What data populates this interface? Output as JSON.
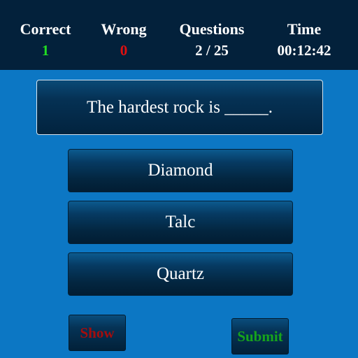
{
  "stats": {
    "correct": {
      "label": "Correct",
      "value": "1"
    },
    "wrong": {
      "label": "Wrong",
      "value": "0"
    },
    "questions": {
      "label": "Questions",
      "value": "2 / 25"
    },
    "time": {
      "label": "Time",
      "value": "00:12:42"
    }
  },
  "question": {
    "text": "The hardest rock is _____."
  },
  "answers": [
    {
      "label": "Diamond"
    },
    {
      "label": "Talc"
    },
    {
      "label": "Quartz"
    }
  ],
  "buttons": {
    "show_label": "Show",
    "submit_label": "Submit"
  },
  "colors": {
    "background": "#0c77c4",
    "header_background": "#03213b",
    "correct_value": "#22dd22",
    "wrong_value": "#e01010",
    "show_text": "#a40d0d",
    "submit_text": "#17a51b"
  }
}
